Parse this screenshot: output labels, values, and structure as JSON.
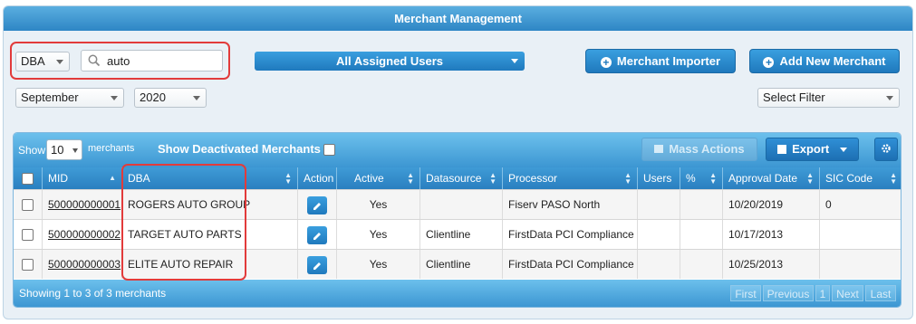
{
  "panel": {
    "title": "Merchant Management"
  },
  "filters": {
    "field_select": "DBA",
    "search_value": "auto",
    "assigned_users": "All Assigned Users",
    "month": "September",
    "year": "2020",
    "select_filter": "Select Filter"
  },
  "buttons": {
    "merchant_importer": "Merchant Importer",
    "add_new_merchant": "Add New Merchant",
    "mass_actions": "Mass Actions",
    "export": "Export"
  },
  "grid": {
    "show_label": "Show",
    "page_size": "10",
    "merchants_label": "merchants",
    "show_deactivated": "Show Deactivated Merchants",
    "columns": [
      "MID",
      "DBA",
      "Action",
      "Active",
      "Datasource",
      "Processor",
      "Users",
      "%",
      "Approval Date",
      "SIC Code"
    ],
    "rows": [
      {
        "mid": "500000000001",
        "dba": "ROGERS AUTO GROUP",
        "active": "Yes",
        "datasource": "",
        "processor": "Fiserv PASO North",
        "users": "",
        "pct": "",
        "approval_date": "10/20/2019",
        "sic": "0"
      },
      {
        "mid": "500000000002",
        "dba": "TARGET AUTO PARTS",
        "active": "Yes",
        "datasource": "Clientline",
        "processor": "FirstData PCI Compliance",
        "users": "",
        "pct": "",
        "approval_date": "10/17/2013",
        "sic": ""
      },
      {
        "mid": "500000000003",
        "dba": "ELITE AUTO REPAIR",
        "active": "Yes",
        "datasource": "Clientline",
        "processor": "FirstData PCI Compliance",
        "users": "",
        "pct": "",
        "approval_date": "10/25/2013",
        "sic": ""
      }
    ],
    "summary": "Showing 1 to 3 of 3 merchants",
    "pager": {
      "first": "First",
      "previous": "Previous",
      "page": "1",
      "next": "Next",
      "last": "Last"
    }
  },
  "colors": {
    "accent": "#1f79bd",
    "header": "#2e86c5",
    "highlight": "#e23b3b"
  }
}
